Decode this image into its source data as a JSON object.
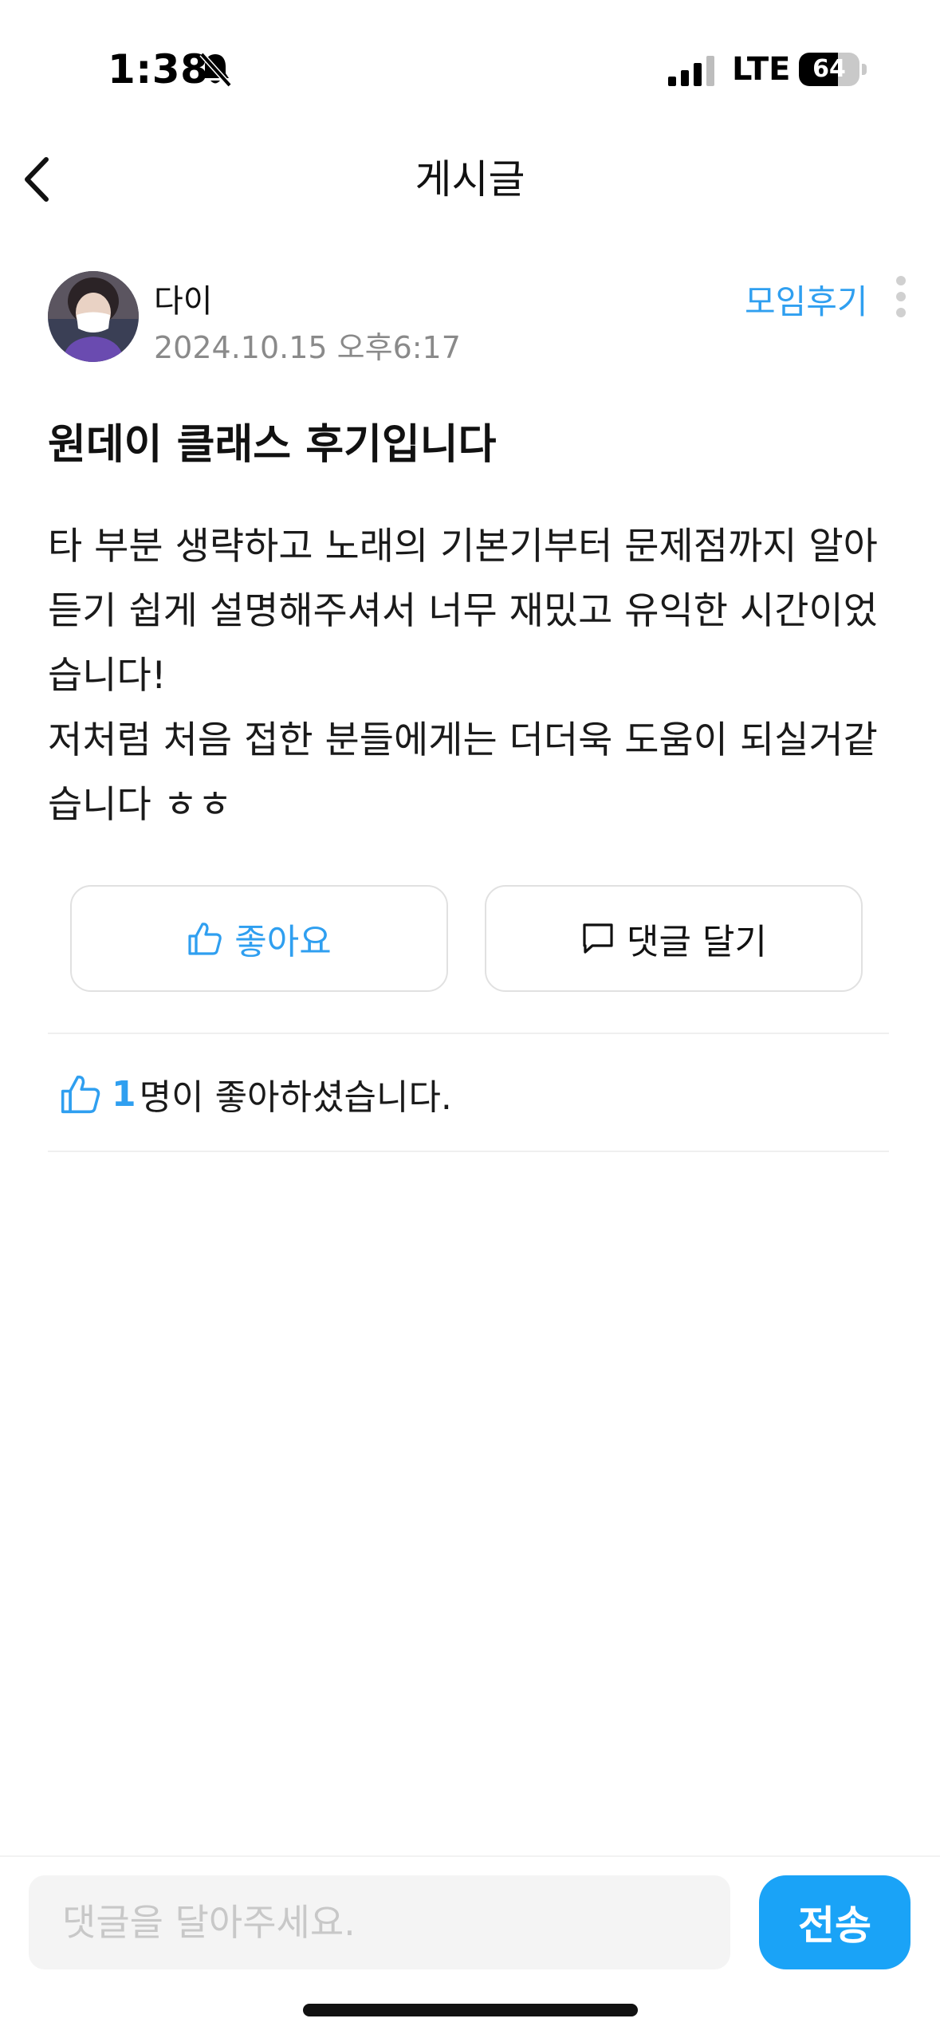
{
  "status_bar": {
    "time": "1:38",
    "network": "LTE",
    "battery_level": "64"
  },
  "nav": {
    "title": "게시글"
  },
  "author": {
    "name": "다이",
    "date": "2024.10.15 오후6:17"
  },
  "post": {
    "category": "모임후기",
    "title": "원데이 클래스 후기입니다",
    "body": "타 부분 생략하고 노래의 기본기부터 문제점까지 알아\n듣기 쉽게 설명해주셔서 너무 재밌고 유익한 시간이었\n습니다!\n저처럼 처음 접한 분들에게는 더더욱 도움이 되실거같\n습니다 ㅎㅎ"
  },
  "actions": {
    "like_label": "좋아요",
    "comment_label": "댓글 달기"
  },
  "likes": {
    "count": "1",
    "suffix": "명이 좋아하셨습니다."
  },
  "comment_bar": {
    "placeholder": "댓글을 달아주세요.",
    "send_label": "전송"
  },
  "colors": {
    "accent": "#2f9ff0",
    "send_button": "#1aa3f7",
    "secondary_text": "#8a8a8a"
  },
  "icons": [
    "bell-slash-icon",
    "signal-icon",
    "battery-icon",
    "back-arrow-icon",
    "more-vertical-icon",
    "thumbs-up-icon",
    "comment-bubble-icon"
  ]
}
